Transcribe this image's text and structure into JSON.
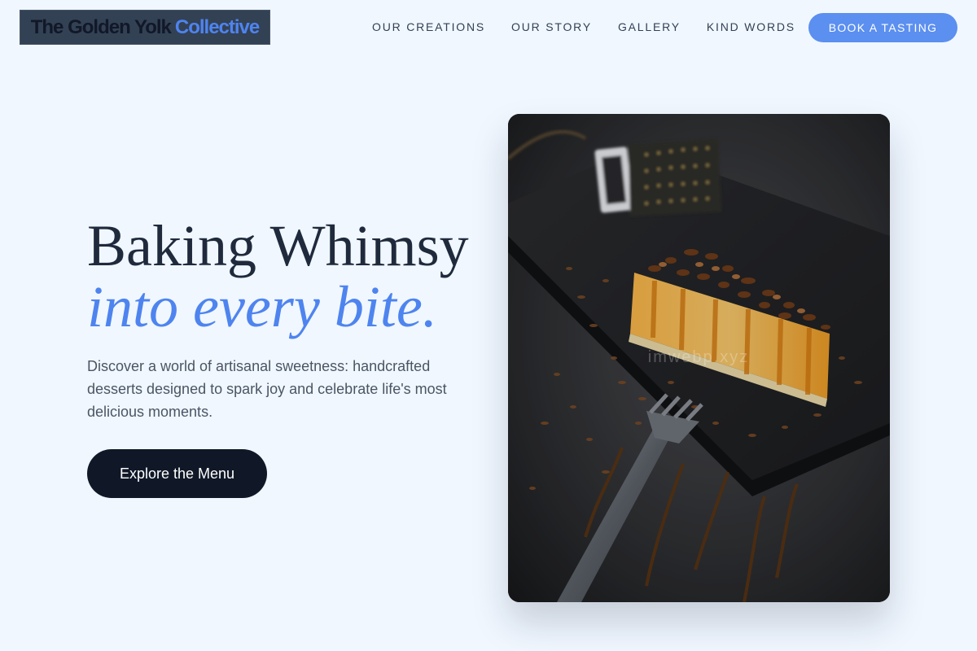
{
  "header": {
    "logo_part1": "The Golden Yolk",
    "logo_part2": "Collective",
    "nav": [
      "OUR CREATIONS",
      "OUR STORY",
      "GALLERY",
      "KIND WORDS"
    ],
    "cta_label": "BOOK A TASTING"
  },
  "hero": {
    "headline": "Baking Whimsy",
    "headline_accent": "into every bite.",
    "subtext": "Discover a world of artisanal sweetness: handcrafted desserts designed to spark joy and celebrate life's most delicious moments.",
    "button_label": "Explore the Menu",
    "image_watermark": "imwebp.xyz"
  },
  "colors": {
    "background": "#f0f7ff",
    "accent": "#4e84ef",
    "dark": "#101828"
  }
}
